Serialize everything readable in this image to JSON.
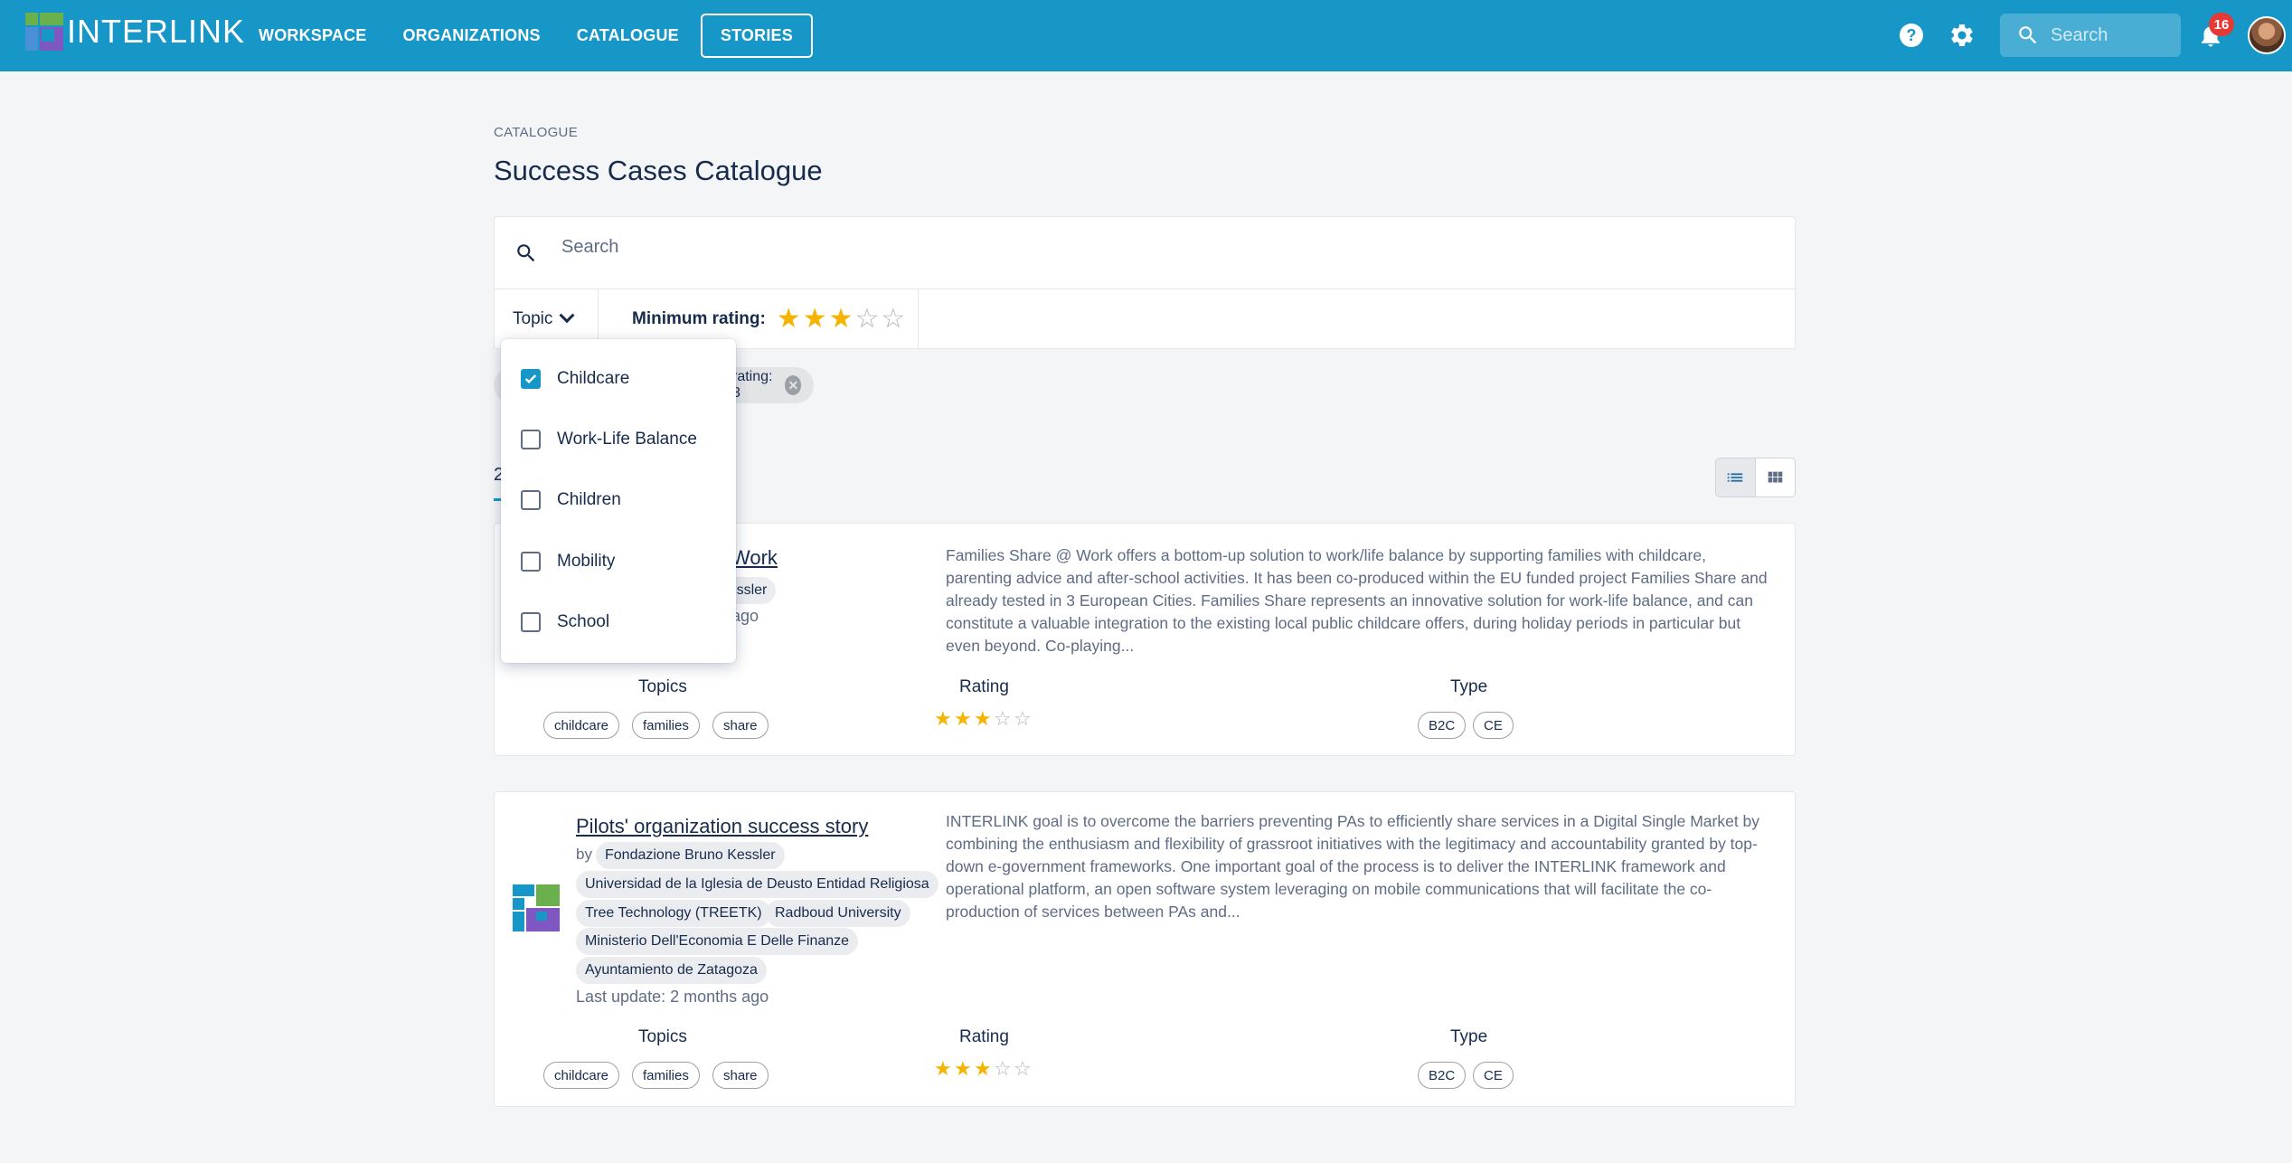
{
  "app": {
    "logo_text": "INTERLINK"
  },
  "nav": [
    {
      "label": "WORKSPACE"
    },
    {
      "label": "ORGANIZATIONS"
    },
    {
      "label": "CATALOGUE"
    },
    {
      "label": "STORIES"
    }
  ],
  "topbar": {
    "search_placeholder": "Search",
    "notifications_count": "16",
    "help_label": "?"
  },
  "page": {
    "breadcrumb": "CATALOGUE",
    "title": "Success Cases Catalogue"
  },
  "filters": {
    "search_placeholder": "Search",
    "topic_label": "Topic",
    "min_rating_label": "Minimum rating:",
    "min_rating_value": 3,
    "active_chips": [
      {
        "label": "rating: 3"
      }
    ]
  },
  "results": {
    "count_label": "2"
  },
  "topic_dropdown": [
    {
      "label": "Childcare",
      "checked": true
    },
    {
      "label": "Work-Life Balance",
      "checked": false
    },
    {
      "label": "Children",
      "checked": false
    },
    {
      "label": "Mobility",
      "checked": false
    },
    {
      "label": "School",
      "checked": false
    }
  ],
  "stories": [
    {
      "title": "Work",
      "org_partial": "Kessler",
      "updated_partial": "ago",
      "description": "Families Share @ Work offers a bottom-up solution to work/life balance by supporting families with childcare, parenting advice and after-school activities. It has been co-produced within the EU funded project Families Share and already tested in 3 European Cities. Families Share represents an innovative solution for work-life balance, and can constitute a valuable integration to the existing local public childcare offers, during holiday periods in particular but even beyond. Co-playing...",
      "topics_label": "Topics",
      "topics": [
        "childcare",
        "families",
        "share"
      ],
      "rating_label": "Rating",
      "rating": 3,
      "type_label": "Type",
      "types": [
        "B2C",
        "CE"
      ]
    },
    {
      "title": "Pilots' organization success story",
      "by_label": "by",
      "orgs": [
        "Fondazione Bruno Kessler",
        "Universidad de la Iglesia de Deusto Entidad Religiosa",
        "Tree Technology (TREETK)",
        "Radboud University",
        "Ministerio Dell'Economia E Delle Finanze",
        "Ayuntamiento de Zatagoza"
      ],
      "updated": "Last update: 2 months ago",
      "description": "INTERLINK goal is to overcome the barriers preventing PAs to efficiently share services in a Digital Single Market by combining the enthusiasm and flexibility of grassroot initiatives with the legitimacy and accountability granted by top-down e-government frameworks. One important goal of the process is to deliver the INTERLINK framework and operational platform, an open software system leveraging on mobile communications that will facilitate the co-production of services between PAs and...",
      "topics_label": "Topics",
      "topics": [
        "childcare",
        "families",
        "share"
      ],
      "rating_label": "Rating",
      "rating": 3,
      "type_label": "Type",
      "types": [
        "B2C",
        "CE"
      ]
    }
  ],
  "colors": {
    "topbar": "#1797c8",
    "star_on": "#f4b400",
    "star_off": "#b0b4ba",
    "badge": "#e53935"
  }
}
